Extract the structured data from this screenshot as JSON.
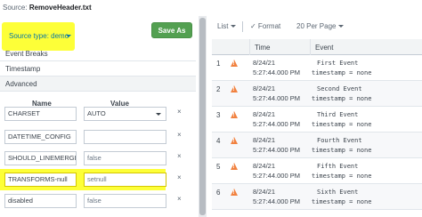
{
  "source": {
    "label": "Source:",
    "name": "RemoveHeader.txt"
  },
  "left": {
    "source_type_label": "Source type: demo",
    "save_as_label": "Save As",
    "menu": [
      "Event Breaks",
      "Timestamp",
      "Advanced"
    ],
    "headers": {
      "name": "Name",
      "value": "Value"
    },
    "rows": [
      {
        "name": "CHARSET",
        "value": "AUTO",
        "highlighted": false
      },
      {
        "name": "DATETIME_CONFIG",
        "value": "",
        "highlighted": false
      },
      {
        "name": "SHOULD_LINEMERGE",
        "value": "false",
        "highlighted": false
      },
      {
        "name": "TRANSFORMS-null",
        "value": "setnull",
        "highlighted": true
      },
      {
        "name": "disabled",
        "value": "false",
        "highlighted": false
      }
    ],
    "delete_glyph": "×"
  },
  "right": {
    "toolbar": {
      "list_label": "List",
      "format_label": "✓ Format",
      "per_page_label": "20 Per Page"
    },
    "columns": {
      "time": "Time",
      "event": "Event"
    },
    "events": [
      {
        "num": "1",
        "date": "8/24/21",
        "time": "5:27:44.000 PM",
        "text": "First Event",
        "meta": "timestamp = none"
      },
      {
        "num": "2",
        "date": "8/24/21",
        "time": "5:27:44.000 PM",
        "text": "Second Event",
        "meta": "timestamp = none"
      },
      {
        "num": "3",
        "date": "8/24/21",
        "time": "5:27:44.000 PM",
        "text": "Third Event",
        "meta": "timestamp = none"
      },
      {
        "num": "4",
        "date": "8/24/21",
        "time": "5:27:44.000 PM",
        "text": "Fourth Event",
        "meta": "timestamp = none"
      },
      {
        "num": "5",
        "date": "8/24/21",
        "time": "5:27:44.000 PM",
        "text": "Fifth Event",
        "meta": "timestamp = none"
      },
      {
        "num": "6",
        "date": "8/24/21",
        "time": "5:27:44.000 PM",
        "text": "Sixth Event",
        "meta": "timestamp = none"
      }
    ]
  },
  "colors": {
    "highlight": "#fdff38",
    "save_button": "#53a051",
    "link": "#0877a6",
    "warning": "#f1813f"
  },
  "icons": {
    "warning": "warning-triangle-icon",
    "delete": "close-icon"
  }
}
